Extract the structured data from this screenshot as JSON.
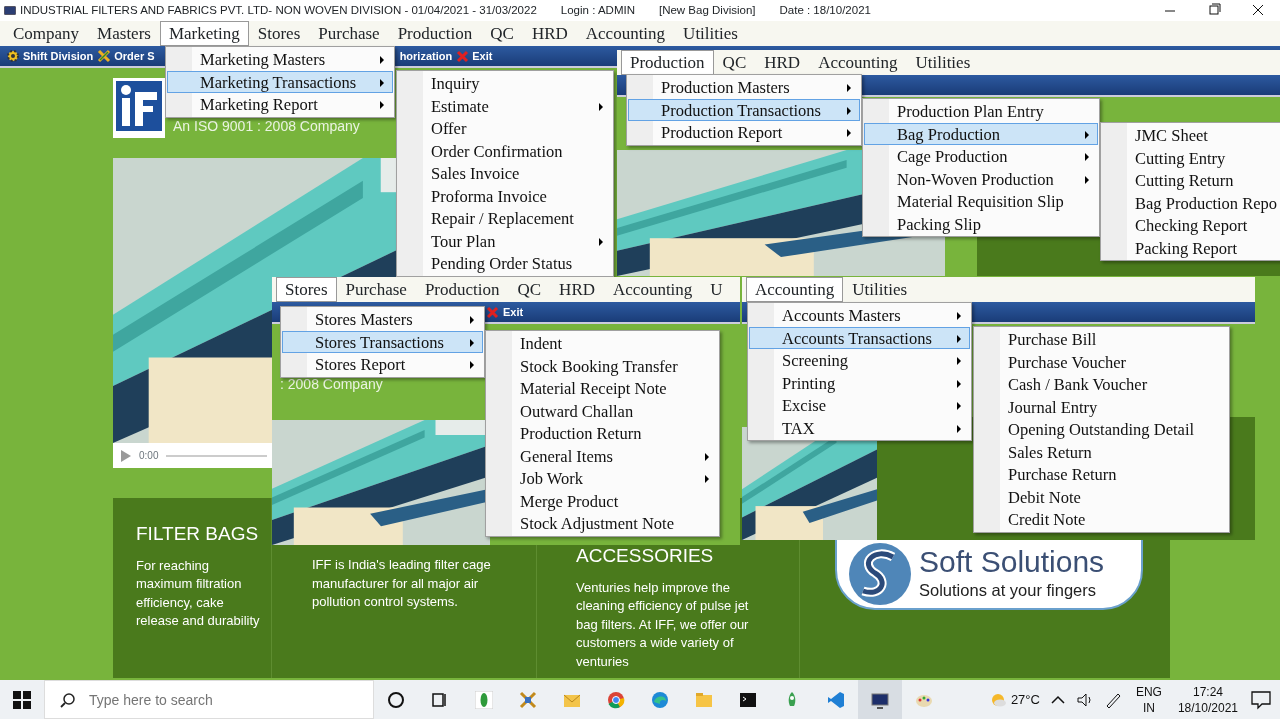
{
  "window": {
    "title": "INDUSTRIAL FILTERS AND FABRICS PVT. LTD- NON WOVEN DIVISION - 01/04/2021 - 31/03/2022",
    "login": "Login : ADMIN",
    "division": "[New Bag Division]",
    "date": "Date : 18/10/2021"
  },
  "menubar": [
    {
      "label": "Company",
      "selected": false
    },
    {
      "label": "Masters",
      "selected": false
    },
    {
      "label": "Marketing",
      "selected": true
    },
    {
      "label": "Stores",
      "selected": false
    },
    {
      "label": "Purchase",
      "selected": false
    },
    {
      "label": "Production",
      "selected": false
    },
    {
      "label": "QC",
      "selected": false
    },
    {
      "label": "HRD",
      "selected": false
    },
    {
      "label": "Accounting",
      "selected": false
    },
    {
      "label": "Utilities",
      "selected": false
    }
  ],
  "toolbar": [
    {
      "label": "Shift Division",
      "kind": "gear"
    },
    {
      "label": "Order S",
      "kind": "order"
    },
    {
      "label": "horization",
      "kind": "plain"
    },
    {
      "label": "Exit",
      "kind": "exit"
    }
  ],
  "main_menus": [
    {
      "items": [
        {
          "label": "Marketing Masters",
          "submenu": true,
          "selected": false
        },
        {
          "label": "Marketing Transactions",
          "submenu": true,
          "selected": true
        },
        {
          "label": "Marketing Report",
          "submenu": true,
          "selected": false
        }
      ]
    },
    {
      "items": [
        {
          "label": "Inquiry",
          "submenu": false,
          "selected": false
        },
        {
          "label": "Estimate",
          "submenu": true,
          "selected": false
        },
        {
          "label": "Offer",
          "submenu": false,
          "selected": false
        },
        {
          "label": "Order Confirmation",
          "submenu": false,
          "selected": false
        },
        {
          "label": "Sales Invoice",
          "submenu": false,
          "selected": false
        },
        {
          "label": "Proforma Invoice",
          "submenu": false,
          "selected": false
        },
        {
          "label": "Repair / Replacement",
          "submenu": false,
          "selected": false
        },
        {
          "label": "Tour Plan",
          "submenu": true,
          "selected": false
        },
        {
          "label": "Pending Order Status",
          "submenu": false,
          "selected": false
        }
      ]
    }
  ],
  "website": {
    "iso_text": "An ISO 9001 : 2008 Company",
    "video_time": "0:00",
    "columns": [
      {
        "heading": "FILTER BAGS",
        "text": "For reaching maximum filtration efficiency, cake release and durability"
      },
      {
        "text": "IFF is India's leading filter cage manufacturer for all major air pollution control systems."
      },
      {
        "heading": "ACCESSORIES",
        "text": "Venturies help improve the cleaning efficiency of pulse jet bag filters. At IFF, we offer our customers a wide variety of venturies"
      }
    ],
    "partner_logo": {
      "name": "Soft Solutions",
      "tagline": "Solutions at your fingers"
    }
  },
  "snippets": [
    {
      "menubar": [
        {
          "label": "Production",
          "selected": true
        },
        {
          "label": "QC",
          "selected": false
        },
        {
          "label": "HRD",
          "selected": false
        },
        {
          "label": "Accounting",
          "selected": false
        },
        {
          "label": "Utilities",
          "selected": false
        }
      ],
      "menus": [
        {
          "items": [
            {
              "label": "Production Masters",
              "submenu": true,
              "selected": false
            },
            {
              "label": "Production Transactions",
              "submenu": true,
              "selected": true
            },
            {
              "label": "Production Report",
              "submenu": true,
              "selected": false
            }
          ]
        },
        {
          "items": [
            {
              "label": "Production Plan Entry",
              "submenu": false,
              "selected": false
            },
            {
              "label": "Bag Production",
              "submenu": true,
              "selected": true
            },
            {
              "label": "Cage Production",
              "submenu": true,
              "selected": false
            },
            {
              "label": "Non-Woven Production",
              "submenu": true,
              "selected": false
            },
            {
              "label": "Material Requisition Slip",
              "submenu": false,
              "selected": false
            },
            {
              "label": "Packing Slip",
              "submenu": false,
              "selected": false
            }
          ]
        },
        {
          "items": [
            {
              "label": "JMC Sheet",
              "submenu": false,
              "selected": false
            },
            {
              "label": "Cutting Entry",
              "submenu": false,
              "selected": false
            },
            {
              "label": "Cutting Return",
              "submenu": false,
              "selected": false
            },
            {
              "label": "Bag Production Repo",
              "submenu": false,
              "selected": false
            },
            {
              "label": "Checking Report",
              "submenu": false,
              "selected": false
            },
            {
              "label": "Packing Report",
              "submenu": false,
              "selected": false
            }
          ]
        }
      ]
    },
    {
      "menubar": [
        {
          "label": "Stores",
          "selected": true
        },
        {
          "label": "Purchase",
          "selected": false
        },
        {
          "label": "Production",
          "selected": false
        },
        {
          "label": "QC",
          "selected": false
        },
        {
          "label": "HRD",
          "selected": false
        },
        {
          "label": "Accounting",
          "selected": false
        },
        {
          "label": "U",
          "selected": false
        }
      ],
      "toolbar": [
        {
          "label": "Exit",
          "kind": "exit"
        }
      ],
      "caption": ": 2008 Company",
      "menus": [
        {
          "items": [
            {
              "label": "Stores Masters",
              "submenu": true,
              "selected": false
            },
            {
              "label": "Stores Transactions",
              "submenu": true,
              "selected": true
            },
            {
              "label": "Stores Report",
              "submenu": true,
              "selected": false
            }
          ]
        },
        {
          "items": [
            {
              "label": "Indent",
              "submenu": false,
              "selected": false
            },
            {
              "label": "Stock Booking Transfer",
              "submenu": false,
              "selected": false
            },
            {
              "label": "Material Receipt Note",
              "submenu": false,
              "selected": false
            },
            {
              "label": "Outward Challan",
              "submenu": false,
              "selected": false
            },
            {
              "label": "Production Return",
              "submenu": false,
              "selected": false
            },
            {
              "label": "General Items",
              "submenu": true,
              "selected": false
            },
            {
              "label": "Job Work",
              "submenu": true,
              "selected": false
            },
            {
              "label": "Merge Product",
              "submenu": false,
              "selected": false
            },
            {
              "label": "Stock Adjustment Note",
              "submenu": false,
              "selected": false
            }
          ]
        }
      ]
    },
    {
      "menubar": [
        {
          "label": "Accounting",
          "selected": true
        },
        {
          "label": "Utilities",
          "selected": false
        }
      ],
      "menus": [
        {
          "items": [
            {
              "label": "Accounts Masters",
              "submenu": true,
              "selected": false
            },
            {
              "label": "Accounts Transactions",
              "submenu": true,
              "selected": true
            },
            {
              "label": "Screening",
              "submenu": true,
              "selected": false
            },
            {
              "label": "Printing",
              "submenu": true,
              "selected": false
            },
            {
              "label": "Excise",
              "submenu": true,
              "selected": false
            },
            {
              "label": "TAX",
              "submenu": true,
              "selected": false
            }
          ]
        },
        {
          "items": [
            {
              "label": "Purchase Bill",
              "submenu": false,
              "selected": false
            },
            {
              "label": "Purchase Voucher",
              "submenu": false,
              "selected": false
            },
            {
              "label": "Cash / Bank Voucher",
              "submenu": false,
              "selected": false
            },
            {
              "label": "Journal Entry",
              "submenu": false,
              "selected": false
            },
            {
              "label": "Opening Outstanding Detail",
              "submenu": false,
              "selected": false
            },
            {
              "label": "Sales Return",
              "submenu": false,
              "selected": false
            },
            {
              "label": "Purchase Return",
              "submenu": false,
              "selected": false
            },
            {
              "label": "Debit Note",
              "submenu": false,
              "selected": false
            },
            {
              "label": "Credit Note",
              "submenu": false,
              "selected": false
            }
          ]
        }
      ]
    }
  ],
  "taskbar": {
    "search": {
      "placeholder": "Type here to search"
    },
    "weather": "27°C",
    "language": "ENG",
    "region": "IN",
    "time": "17:24",
    "date": "18/10/2021"
  }
}
